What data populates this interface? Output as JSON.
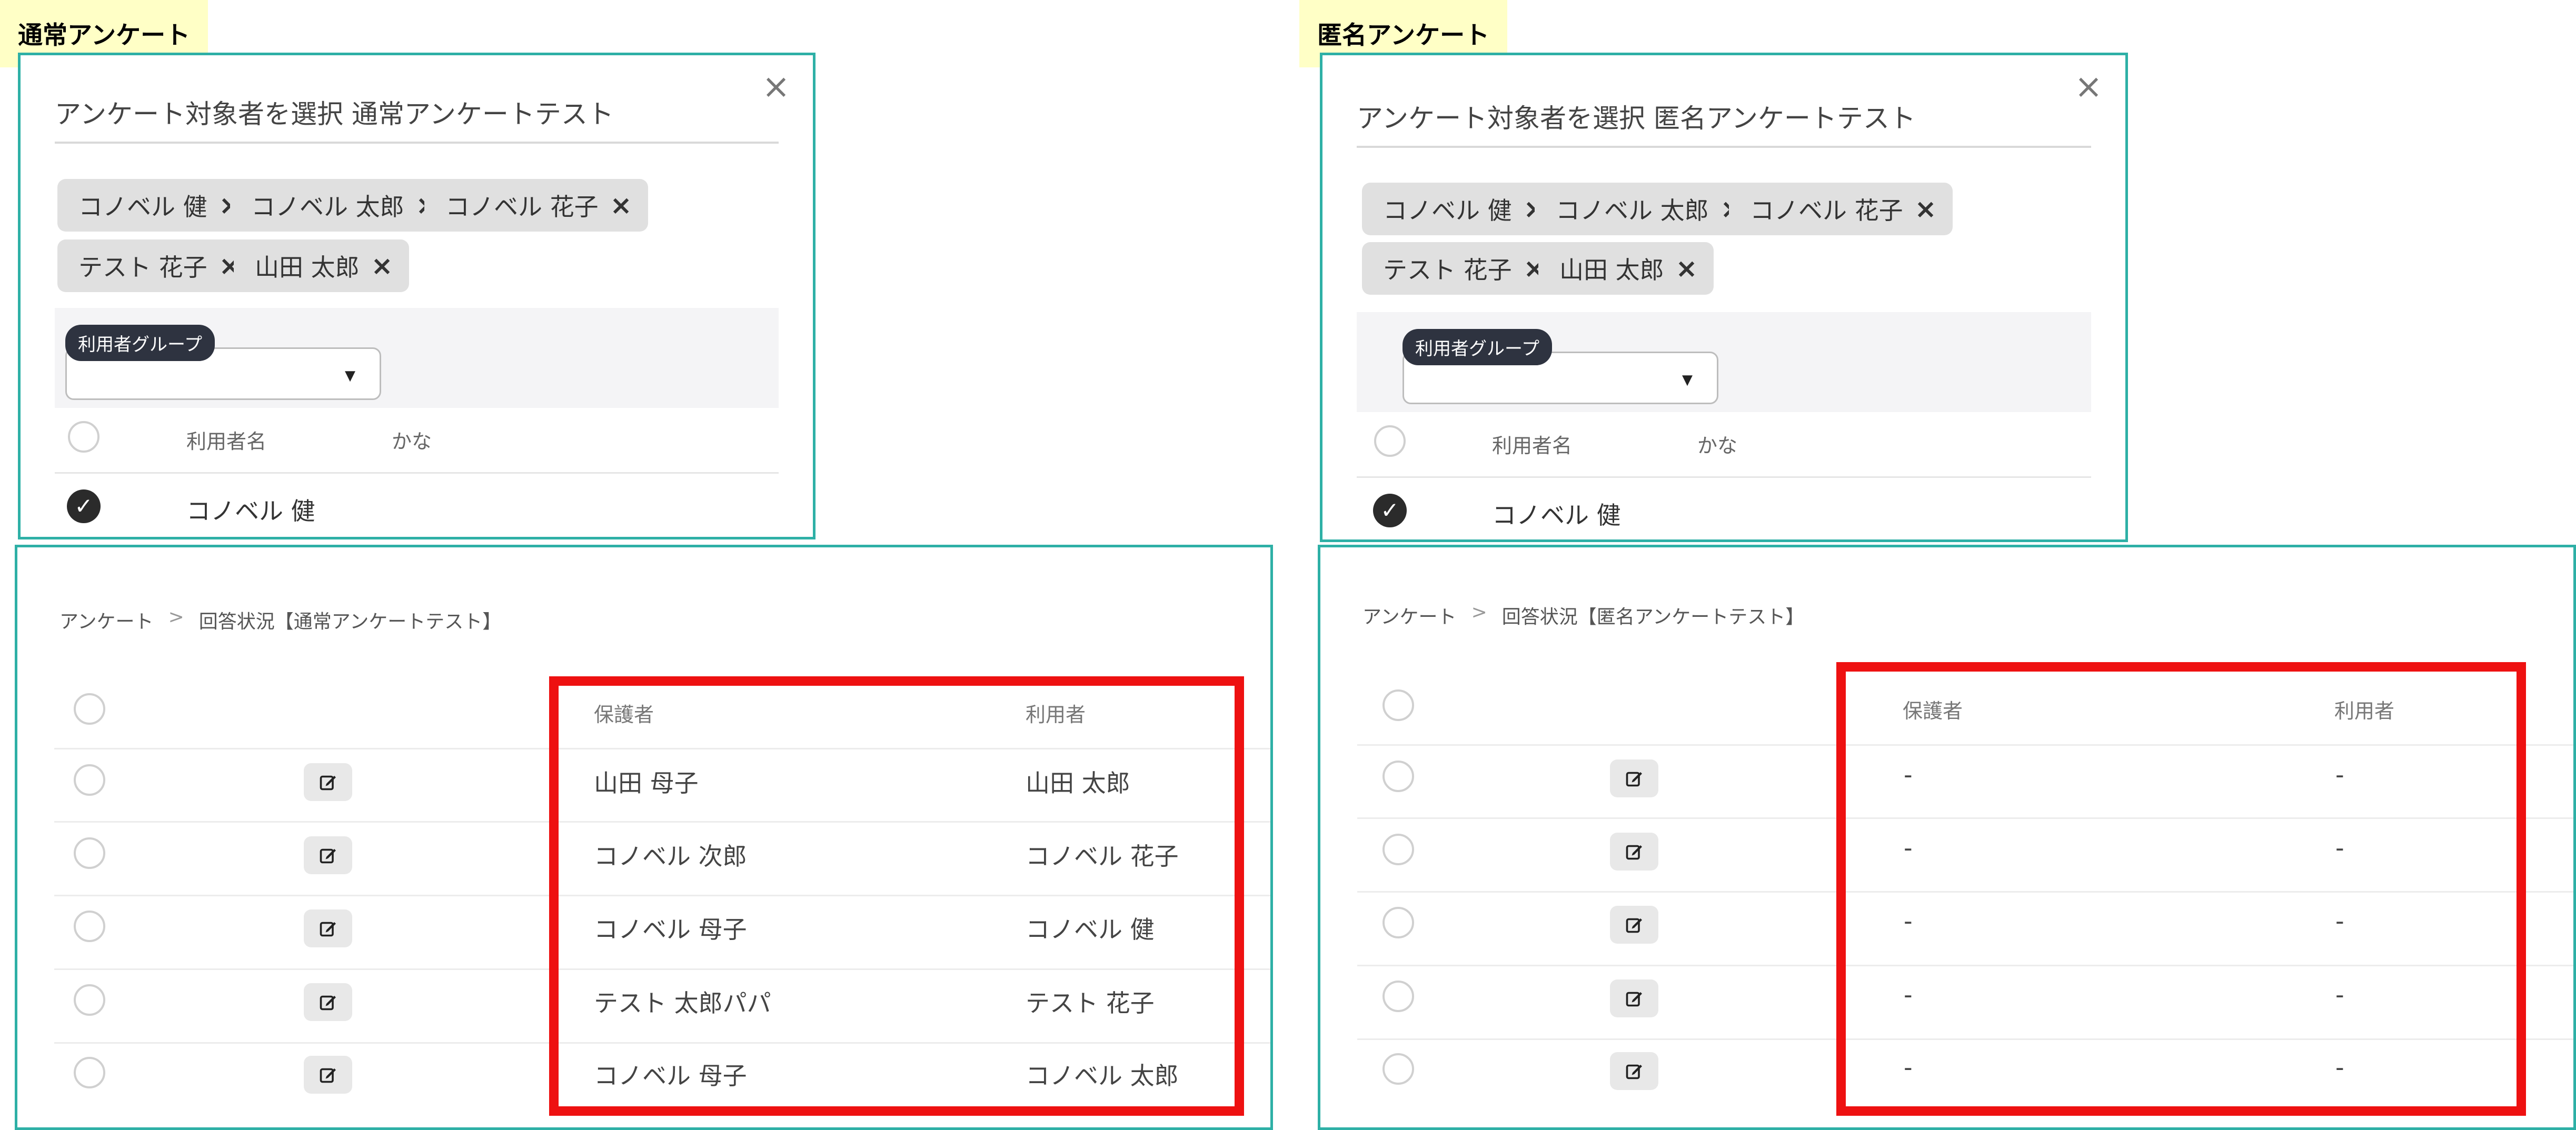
{
  "left": {
    "label": "通常アンケート",
    "dialog": {
      "title": "アンケート対象者を選択 通常アンケートテスト",
      "chips": [
        "コノベル 健",
        "コノベル 太郎",
        "コノベル 花子",
        "テスト 花子",
        "山田 太郎"
      ],
      "group_label": "利用者グループ",
      "group_value": "",
      "columns": [
        "利用者名",
        "かな"
      ],
      "first_row": "コノベル 健"
    },
    "panel": {
      "breadcrumb": [
        "アンケート",
        "回答状況【通常アンケートテスト】"
      ],
      "headers": [
        "保護者",
        "利用者"
      ],
      "rows": [
        {
          "guardian": "山田 母子",
          "user": "山田 太郎"
        },
        {
          "guardian": "コノベル 次郎",
          "user": "コノベル 花子"
        },
        {
          "guardian": "コノベル 母子",
          "user": "コノベル 健"
        },
        {
          "guardian": "テスト 太郎パパ",
          "user": "テスト 花子"
        },
        {
          "guardian": "コノベル 母子",
          "user": "コノベル 太郎"
        }
      ]
    }
  },
  "right": {
    "label": "匿名アンケート",
    "dialog": {
      "title": "アンケート対象者を選択 匿名アンケートテスト",
      "chips": [
        "コノベル 健",
        "コノベル 太郎",
        "コノベル 花子",
        "テスト 花子",
        "山田 太郎"
      ],
      "group_label": "利用者グループ",
      "group_value": "",
      "columns": [
        "利用者名",
        "かな"
      ],
      "first_row": "コノベル 健"
    },
    "panel": {
      "breadcrumb": [
        "アンケート",
        "回答状況【匿名アンケートテスト】"
      ],
      "headers": [
        "保護者",
        "利用者"
      ],
      "rows": [
        {
          "guardian": "-",
          "user": "-"
        },
        {
          "guardian": "-",
          "user": "-"
        },
        {
          "guardian": "-",
          "user": "-"
        },
        {
          "guardian": "-",
          "user": "-"
        },
        {
          "guardian": "-",
          "user": "-"
        }
      ]
    }
  },
  "icons": {
    "close": "close-icon",
    "chip_remove": "close-icon",
    "caret": "caret-down-icon",
    "check": "check-icon",
    "edit": "edit-icon"
  },
  "colors": {
    "panel_border": "#2eb0a6",
    "label_bg": "#ffffc6",
    "highlight": "#ee1111",
    "group_tag_bg": "#2e3340"
  }
}
